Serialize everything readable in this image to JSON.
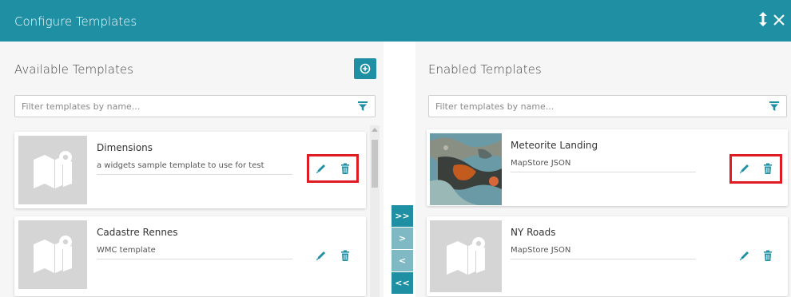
{
  "header": {
    "title": "Configure Templates",
    "resize_icon": "vertical-resize-icon",
    "close_icon": "close-icon",
    "bg_color": "#1f8fa3"
  },
  "available": {
    "title": "Available Templates",
    "add_icon": "plus-circle-icon",
    "filter_placeholder": "Filter templates by name...",
    "filter_icon": "funnel-icon",
    "templates": [
      {
        "name": "Dimensions",
        "description": "a widgets sample template to use for test",
        "thumbnail": "map-placeholder-icon",
        "highlighted": true
      },
      {
        "name": "Cadastre Rennes",
        "description": "WMC template",
        "thumbnail": "map-placeholder-icon",
        "highlighted": false
      }
    ]
  },
  "enabled": {
    "title": "Enabled Templates",
    "filter_placeholder": "Filter templates by name...",
    "filter_icon": "funnel-icon",
    "templates": [
      {
        "name": "Meteorite Landing",
        "description": "MapStore JSON",
        "thumbnail": "map-image-thumbnail",
        "highlighted": true
      },
      {
        "name": "NY Roads",
        "description": "MapStore JSON",
        "thumbnail": "map-placeholder-icon",
        "highlighted": false
      }
    ]
  },
  "transfer": {
    "move_all_right": ">>",
    "move_right": ">",
    "move_left": "<",
    "move_all_left": "<<"
  },
  "colors": {
    "accent": "#1f8fa3",
    "accent_light": "#7fb9c4",
    "highlight": "#e01b24"
  }
}
